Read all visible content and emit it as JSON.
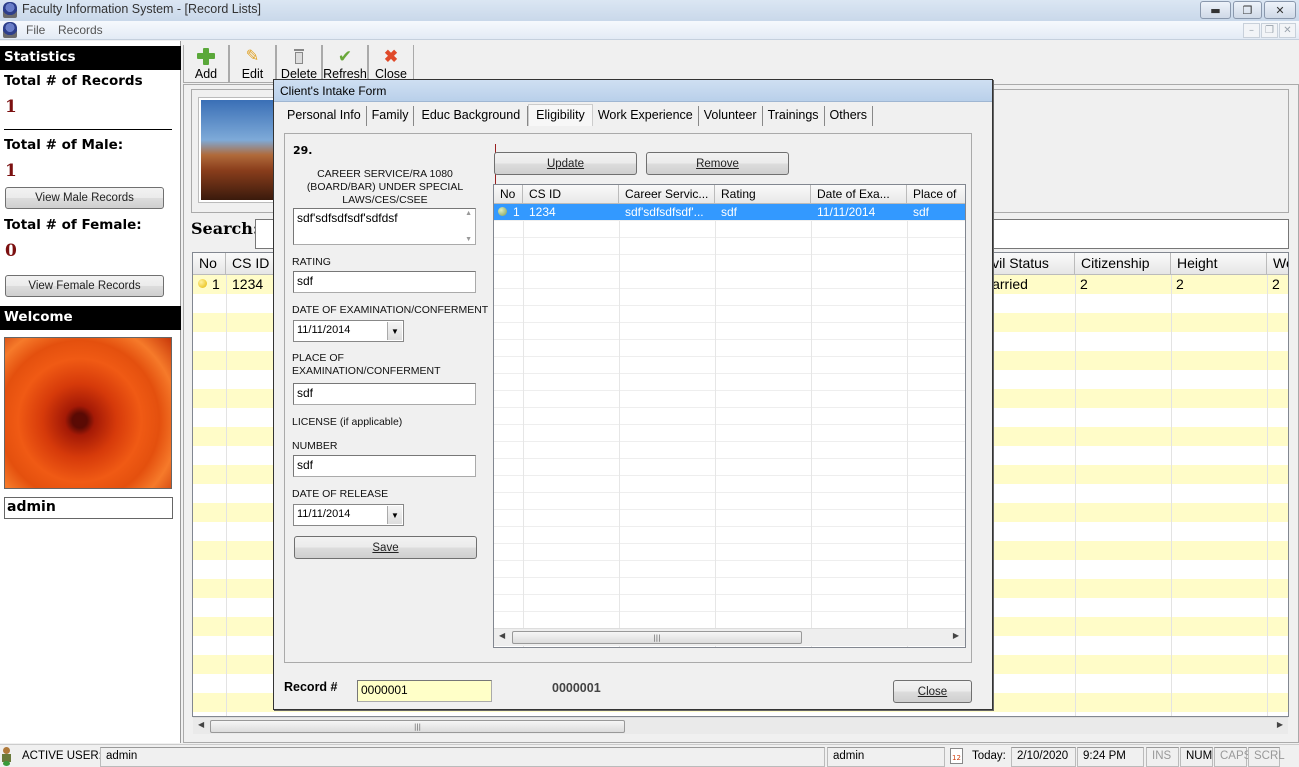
{
  "window": {
    "title": "Faculty Information System - [Record Lists]",
    "controls": [
      "minimize",
      "restore",
      "close"
    ]
  },
  "menu": {
    "items": [
      "File",
      "Records"
    ]
  },
  "toolbar": {
    "buttons": [
      {
        "label": "Add",
        "icon": "add-icon"
      },
      {
        "label": "Edit",
        "icon": "pencil-icon"
      },
      {
        "label": "Delete",
        "icon": "trash-icon"
      },
      {
        "label": "Refresh",
        "icon": "check-icon"
      },
      {
        "label": "Close",
        "icon": "close-icon"
      }
    ]
  },
  "statistics": {
    "header": "Statistics",
    "total_records_label": "Total # of Records",
    "total_records": "1",
    "total_male_label": "Total # of Male:",
    "total_male": "1",
    "view_male_button": "View Male Records",
    "total_female_label": "Total # of Female:",
    "total_female": "0",
    "view_female_button": "View Female Records"
  },
  "welcome": {
    "header": "Welcome",
    "username": "admin"
  },
  "main": {
    "search_label": "Search:",
    "search_value": "",
    "grid": {
      "columns": [
        "No",
        "CS ID",
        "ivil Status",
        "Citizenship",
        "Height",
        "We"
      ],
      "rows": [
        {
          "no": "1",
          "cs_id": "1234",
          "civil_status": "larried",
          "citizenship": "2",
          "height": "2",
          "weight": "2"
        }
      ]
    }
  },
  "dialog": {
    "title": "Client's Intake Form",
    "tabs": [
      "Personal Info",
      "Family",
      "Educ Background",
      "Eligibility",
      "Work Experience",
      "Volunteer",
      "Trainings",
      "Others"
    ],
    "active_tab": "Eligibility",
    "section_number": "29.",
    "career_service_label": "CAREER SERVICE/RA 1080 (BOARD/BAR) UNDER SPECIAL LAWS/CES/CSEE",
    "career_service_value": "sdf'sdfsdfsdf'sdfdsf",
    "rating_label": "RATING",
    "rating_value": "sdf",
    "exam_date_label": "DATE OF EXAMINATION/CONFERMENT",
    "exam_date_value": "11/11/2014",
    "exam_place_label": "PLACE OF EXAMINATION/CONFERMENT",
    "exam_place_value": "sdf",
    "license_label": "LICENSE (if applicable)",
    "number_label": "NUMBER",
    "number_value": "sdf",
    "release_date_label": "DATE OF RELEASE",
    "release_date_value": "11/11/2014",
    "save_button": "Save",
    "update_button": "Update",
    "remove_button": "Remove",
    "grid": {
      "columns": [
        "No",
        "CS ID",
        "Career Servic...",
        "Rating",
        "Date of Exa...",
        "Place of"
      ],
      "rows": [
        {
          "no": "1",
          "cs_id": "1234",
          "career_service": "sdf'sdfsdfsdf'...",
          "rating": "sdf",
          "exam_date": "11/11/2014",
          "place": "sdf",
          "selected": true
        }
      ]
    },
    "record_label": "Record #",
    "record_value": "0000001",
    "record_display": "0000001",
    "close_button": "Close"
  },
  "statusbar": {
    "active_user_label": "ACTIVE USER:",
    "active_user": "admin",
    "user_field": "admin",
    "today_label": "Today:",
    "date": "2/10/2020",
    "time": "9:24 PM",
    "indicators": [
      "INS",
      "NUM",
      "CAPS",
      "SCRL"
    ]
  },
  "colors": {
    "stat_value": "#7b1010",
    "row_highlight": "#fffcc8",
    "selection": "#3399ff",
    "divider": "#9a2020"
  }
}
